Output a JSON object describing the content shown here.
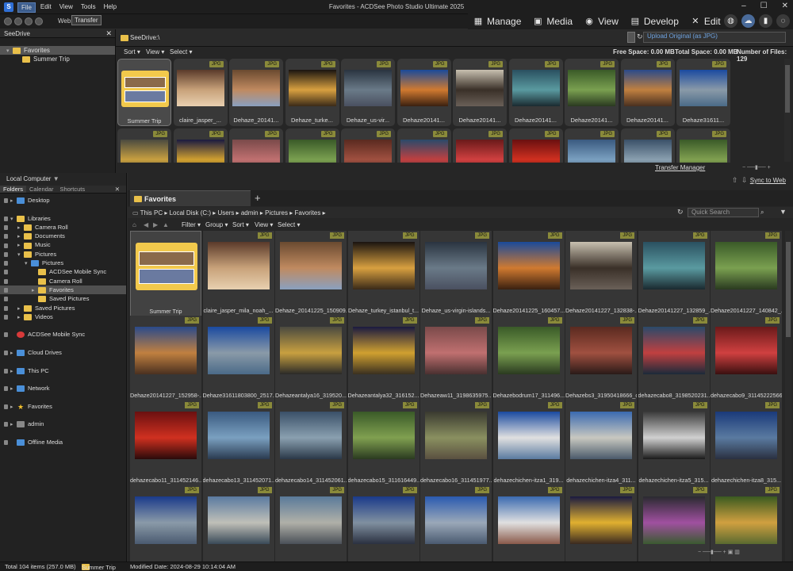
{
  "app": {
    "title": "Favorites - ACDSee Photo Studio Ultimate 2025",
    "menu": [
      "File",
      "Edit",
      "View",
      "Tools",
      "Help"
    ],
    "web_label": "Web",
    "transfer_label": "Transfer",
    "modes": [
      "Manage",
      "Media",
      "View",
      "Develop",
      "Edit"
    ]
  },
  "seedrive": {
    "title": "SeeDrive",
    "tree": [
      "Favorites",
      "Summer Trip"
    ],
    "path": "SeeDrive:\\",
    "upload_option": "Upload Original (as JPG)",
    "sort": "Sort",
    "view": "View",
    "select": "Select",
    "free_space": "Free Space: 0.00 MB",
    "total_space": "Total Space: 0.00 MB",
    "num_files": "Number of Files: 129",
    "transfer_manager": "Transfer Manager",
    "thumbs": [
      {
        "name": "Summer Trip",
        "tag": "",
        "type": "folder"
      },
      {
        "name": "claire_jasper_...",
        "tag": "JPG",
        "type": "img",
        "c": [
          "#5a3a2a",
          "#c8a27a",
          "#e8d0b0"
        ]
      },
      {
        "name": "Dehaze_20141...",
        "tag": "JPG",
        "type": "img",
        "c": [
          "#6a4a30",
          "#c08a60",
          "#8aa0c0"
        ]
      },
      {
        "name": "Dehaze_turke...",
        "tag": "JPG",
        "type": "img",
        "c": [
          "#1a1410",
          "#d8a040",
          "#3a2a18"
        ]
      },
      {
        "name": "Dehaze_us-vir...",
        "tag": "JPG",
        "type": "img",
        "c": [
          "#2a3440",
          "#6a7a88",
          "#4a5060"
        ]
      },
      {
        "name": "Dehaze20141...",
        "tag": "JPG",
        "type": "img",
        "c": [
          "#1a4a9a",
          "#d07a30",
          "#3a2010"
        ]
      },
      {
        "name": "Dehaze20141...",
        "tag": "JPG",
        "type": "img",
        "c": [
          "#c8c0b0",
          "#3a3028",
          "#6a6058"
        ]
      },
      {
        "name": "Dehaze20141...",
        "tag": "JPG",
        "type": "img",
        "c": [
          "#2a5060",
          "#5a9aa0",
          "#1a2a30"
        ]
      },
      {
        "name": "Dehaze20141...",
        "tag": "JPG",
        "type": "img",
        "c": [
          "#3a5a28",
          "#7aa050",
          "#2a3a20"
        ]
      },
      {
        "name": "Dehaze20141...",
        "tag": "JPG",
        "type": "img",
        "c": [
          "#2a4a8a",
          "#c08040",
          "#4a3020"
        ]
      },
      {
        "name": "Dehaze31611...",
        "tag": "JPG",
        "type": "img",
        "c": [
          "#1a4aa0",
          "#8a9aa8",
          "#4a6a88"
        ]
      },
      {
        "name": "",
        "tag": "JPG",
        "type": "img",
        "c": [
          "#4a4a40",
          "#c8a040",
          "#2a2a28"
        ]
      },
      {
        "name": "",
        "tag": "JPG",
        "type": "img",
        "c": [
          "#1a1a40",
          "#d0a030",
          "#3a3020"
        ]
      },
      {
        "name": "",
        "tag": "JPG",
        "type": "img",
        "c": [
          "#7a4a4a",
          "#c07070",
          "#4a3030"
        ]
      },
      {
        "name": "",
        "tag": "JPG",
        "type": "img",
        "c": [
          "#3a5a28",
          "#7aa050",
          "#2a3a20"
        ]
      },
      {
        "name": "",
        "tag": "JPG",
        "type": "img",
        "c": [
          "#5a2a20",
          "#a05040",
          "#2a1a18"
        ]
      },
      {
        "name": "",
        "tag": "JPG",
        "type": "img",
        "c": [
          "#2a4a6a",
          "#c04040",
          "#1a2a3a"
        ]
      },
      {
        "name": "",
        "tag": "JPG",
        "type": "img",
        "c": [
          "#6a1a1a",
          "#d04040",
          "#3a1010"
        ]
      },
      {
        "name": "",
        "tag": "JPG",
        "type": "img",
        "c": [
          "#6a1010",
          "#d03020",
          "#2a0a0a"
        ]
      },
      {
        "name": "",
        "tag": "JPG",
        "type": "img",
        "c": [
          "#3a5a80",
          "#7aa0c0",
          "#2a3a50"
        ]
      },
      {
        "name": "",
        "tag": "JPG",
        "type": "img",
        "c": [
          "#3a5068",
          "#8aa0b0",
          "#2a3848"
        ]
      },
      {
        "name": "",
        "tag": "JPG",
        "type": "img",
        "c": [
          "#3a5a28",
          "#80a050",
          "#2a3a20"
        ]
      }
    ]
  },
  "local": {
    "title": "Local Computer",
    "tabs": [
      "Folders",
      "Calendar",
      "Shortcuts"
    ],
    "tree": [
      {
        "label": "Desktop",
        "indent": 1,
        "icon": "blue",
        "arrow": "▸"
      },
      {
        "label": "",
        "indent": 0,
        "icon": "",
        "arrow": ""
      },
      {
        "label": "Libraries",
        "indent": 1,
        "icon": "gold",
        "arrow": "▾"
      },
      {
        "label": "Camera Roll",
        "indent": 2,
        "icon": "gold",
        "arrow": "▸"
      },
      {
        "label": "Documents",
        "indent": 2,
        "icon": "gold",
        "arrow": "▸"
      },
      {
        "label": "Music",
        "indent": 2,
        "icon": "gold",
        "arrow": "▸"
      },
      {
        "label": "Pictures",
        "indent": 2,
        "icon": "gold",
        "arrow": "▾"
      },
      {
        "label": "Pictures",
        "indent": 3,
        "icon": "blue",
        "arrow": "▾"
      },
      {
        "label": "ACDSee Mobile Sync",
        "indent": 4,
        "icon": "gold",
        "arrow": ""
      },
      {
        "label": "Camera Roll",
        "indent": 4,
        "icon": "gold",
        "arrow": ""
      },
      {
        "label": "Favorites",
        "indent": 4,
        "icon": "gold",
        "arrow": "▸",
        "sel": true
      },
      {
        "label": "Saved Pictures",
        "indent": 4,
        "icon": "gold",
        "arrow": ""
      },
      {
        "label": "Saved Pictures",
        "indent": 2,
        "icon": "gold",
        "arrow": "▸"
      },
      {
        "label": "Videos",
        "indent": 2,
        "icon": "gold",
        "arrow": "▸"
      },
      {
        "label": "",
        "indent": 0,
        "icon": "",
        "arrow": ""
      },
      {
        "label": "ACDSee Mobile Sync",
        "indent": 1,
        "icon": "red",
        "arrow": ""
      },
      {
        "label": "",
        "indent": 0,
        "icon": "",
        "arrow": ""
      },
      {
        "label": "Cloud Drives",
        "indent": 1,
        "icon": "blue",
        "arrow": "▸"
      },
      {
        "label": "",
        "indent": 0,
        "icon": "",
        "arrow": ""
      },
      {
        "label": "This PC",
        "indent": 1,
        "icon": "blue",
        "arrow": "▸"
      },
      {
        "label": "",
        "indent": 0,
        "icon": "",
        "arrow": ""
      },
      {
        "label": "Network",
        "indent": 1,
        "icon": "blue",
        "arrow": "▸"
      },
      {
        "label": "",
        "indent": 0,
        "icon": "",
        "arrow": ""
      },
      {
        "label": "Favorites",
        "indent": 1,
        "icon": "star",
        "arrow": "▸"
      },
      {
        "label": "",
        "indent": 0,
        "icon": "",
        "arrow": ""
      },
      {
        "label": "admin",
        "indent": 1,
        "icon": "gray",
        "arrow": "▸"
      },
      {
        "label": "",
        "indent": 0,
        "icon": "",
        "arrow": ""
      },
      {
        "label": "Offline Media",
        "indent": 1,
        "icon": "blue",
        "arrow": ""
      }
    ]
  },
  "browser": {
    "sync_to_web": "Sync to Web",
    "tab": "Favorites",
    "breadcrumb": [
      "This PC",
      "Local Disk (C:)",
      "Users",
      "admin",
      "Pictures",
      "Favorites"
    ],
    "quick_search": "Quick Search",
    "filters": [
      "Filter",
      "Group",
      "Sort",
      "View",
      "Select"
    ],
    "items": [
      {
        "name": "Summer Trip",
        "tag": "",
        "type": "folder"
      },
      {
        "name": "claire_jasper_mila_noah_...",
        "tag": "JPG",
        "c": [
          "#5a3a2a",
          "#c8a27a",
          "#e8d0b0"
        ]
      },
      {
        "name": "Dehaze_20141225_150909...",
        "tag": "JPG",
        "c": [
          "#6a4a30",
          "#c08a60",
          "#8aa0c0"
        ]
      },
      {
        "name": "Dehaze_turkey_istanbul_t...",
        "tag": "JPG",
        "c": [
          "#1a1410",
          "#d8a040",
          "#3a2a18"
        ]
      },
      {
        "name": "Dehaze_us-virgin-islands...",
        "tag": "JPG",
        "c": [
          "#2a3440",
          "#6a7a88",
          "#4a5060"
        ]
      },
      {
        "name": "Dehaze20141225_160457...",
        "tag": "JPG",
        "c": [
          "#1a4a9a",
          "#d07a30",
          "#3a2010"
        ]
      },
      {
        "name": "Dehaze20141227_132838-...",
        "tag": "JPG",
        "c": [
          "#c8c0b0",
          "#3a3028",
          "#6a6058"
        ]
      },
      {
        "name": "Dehaze20141227_132859_...",
        "tag": "JPG",
        "c": [
          "#2a5060",
          "#5a9aa0",
          "#1a2a30"
        ]
      },
      {
        "name": "Dehaze20141227_140842_...",
        "tag": "JPG",
        "c": [
          "#3a5a28",
          "#7aa050",
          "#2a3a20"
        ]
      },
      {
        "name": "Dehaze20141227_152958-...",
        "tag": "JPG",
        "c": [
          "#2a4a8a",
          "#c08040",
          "#4a3020"
        ]
      },
      {
        "name": "Dehaze31611803800_2517...",
        "tag": "JPG",
        "c": [
          "#1a4aa0",
          "#8a9aa8",
          "#4a6a88"
        ]
      },
      {
        "name": "Dehazeantalya16_319520...",
        "tag": "JPG",
        "c": [
          "#4a4a40",
          "#c8a040",
          "#2a2a28"
        ]
      },
      {
        "name": "Dehazeantalya32_316152...",
        "tag": "JPG",
        "c": [
          "#1a1a40",
          "#d0a030",
          "#3a3020"
        ]
      },
      {
        "name": "Dehazeaw11_3198635975...",
        "tag": "JPG",
        "c": [
          "#7a4a4a",
          "#c07070",
          "#4a3030"
        ]
      },
      {
        "name": "Dehazebodrum17_311496...",
        "tag": "JPG",
        "c": [
          "#3a5a28",
          "#7aa050",
          "#2a3a20"
        ]
      },
      {
        "name": "Dehazebs3_31950418666_o...",
        "tag": "JPG",
        "c": [
          "#5a2a20",
          "#a05040",
          "#2a1a18"
        ]
      },
      {
        "name": "dehazecabo8_3198520231...",
        "tag": "JPG",
        "c": [
          "#2a4a6a",
          "#c04040",
          "#1a2a3a"
        ]
      },
      {
        "name": "dehazecabo9_31145222566...",
        "tag": "JPG",
        "c": [
          "#6a1a1a",
          "#d04040",
          "#3a1010"
        ]
      },
      {
        "name": "dehazecabo11_311452146...",
        "tag": "JPG",
        "c": [
          "#6a1010",
          "#d03020",
          "#2a0a0a"
        ]
      },
      {
        "name": "dehazecabo13_311452071...",
        "tag": "JPG",
        "c": [
          "#3a5a80",
          "#7aa0c0",
          "#2a3a50"
        ]
      },
      {
        "name": "dehazecabo14_311452061...",
        "tag": "JPG",
        "c": [
          "#3a5068",
          "#8aa0b0",
          "#2a3848"
        ]
      },
      {
        "name": "dehazecabo15_311616449...",
        "tag": "JPG",
        "c": [
          "#3a5a28",
          "#80a050",
          "#2a3a20"
        ]
      },
      {
        "name": "dehazecabo16_311451977...",
        "tag": "JPG",
        "c": [
          "#3a3a30",
          "#8a9060",
          "#5a5040"
        ]
      },
      {
        "name": "dehazechichen-itza1_319...",
        "tag": "JPG",
        "c": [
          "#1a4aa0",
          "#e0e0e0",
          "#5a7aa0"
        ]
      },
      {
        "name": "dehazechichen-itza4_311...",
        "tag": "JPG",
        "c": [
          "#3a6ab0",
          "#c8c8c0",
          "#4a5a6a"
        ]
      },
      {
        "name": "dehazechichen-itza5_315...",
        "tag": "JPG",
        "c": [
          "#3a3a3a",
          "#d0d0d0",
          "#1a1a1a"
        ]
      },
      {
        "name": "dehazechichen-itza8_315...",
        "tag": "JPG",
        "c": [
          "#1a3a7a",
          "#5a7aa0",
          "#2a3040"
        ]
      },
      {
        "name": "",
        "tag": "JPG",
        "c": [
          "#1a3a8a",
          "#8a9aa8",
          "#4a5a70"
        ]
      },
      {
        "name": "",
        "tag": "JPG",
        "c": [
          "#5a7aa0",
          "#c0c0b8",
          "#3a4a58"
        ]
      },
      {
        "name": "",
        "tag": "JPG",
        "c": [
          "#5a7a9a",
          "#b0b0a8",
          "#4a5058"
        ]
      },
      {
        "name": "",
        "tag": "JPG",
        "c": [
          "#1a3a8a",
          "#8090a0",
          "#2a3040"
        ]
      },
      {
        "name": "",
        "tag": "JPG",
        "c": [
          "#2a5ab0",
          "#9aa8b8",
          "#4a5a70"
        ]
      },
      {
        "name": "",
        "tag": "JPG",
        "c": [
          "#3a6ab0",
          "#e0e0e0",
          "#8a5a4a"
        ]
      },
      {
        "name": "",
        "tag": "JPG",
        "c": [
          "#1a1a40",
          "#e0b030",
          "#3a2a20"
        ]
      },
      {
        "name": "",
        "tag": "JPG",
        "c": [
          "#2a2a30",
          "#a050a0",
          "#3a5a30"
        ]
      },
      {
        "name": "",
        "tag": "JPG",
        "c": [
          "#3a5a20",
          "#d0a040",
          "#5a6a30"
        ]
      }
    ]
  },
  "status": {
    "total": "Total 104 items  (257.0 MB)",
    "selected": "Summer Trip",
    "modified": "Modified Date: 2024-08-29 10:14:04 AM"
  }
}
